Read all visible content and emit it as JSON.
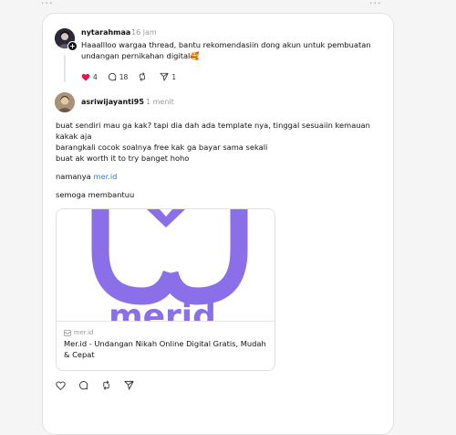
{
  "top_menu": {
    "left_icon": "more-icon",
    "right_icon": "more-icon"
  },
  "original_post": {
    "username": "nytarahmaa",
    "time": "16 jam",
    "text_line1": "Haaallloo wargaa thread, bantu rekomendasiin dong akun untuk pembuatan",
    "text_line2": "undangan pernikahan digital",
    "emoji": "🥰",
    "likes": "4",
    "comments": "18",
    "shares": "1",
    "like_color": "#e8174a"
  },
  "reply": {
    "username": "asriwijayanti95",
    "time": "1 menit",
    "line1": "buat sendiri mau ga kak? tapi dia dah ada template nya, tinggal sesuaiin kemauan",
    "line2": "kakak aja",
    "line3": "barangkali cocok soalnya free kak ga bayar sama sekali",
    "line4": "buat ak worth it to try banget hoho",
    "name_prefix": "namanya ",
    "name_link": "mer.id",
    "closing": "semoga membantuu"
  },
  "link_preview": {
    "image_text": "merid",
    "domain": "mer.id",
    "title": "Mer.id - Undangan Nikah Online Digital Gratis, Mudah & Cepat",
    "brand_color": "#8a6fe8"
  }
}
